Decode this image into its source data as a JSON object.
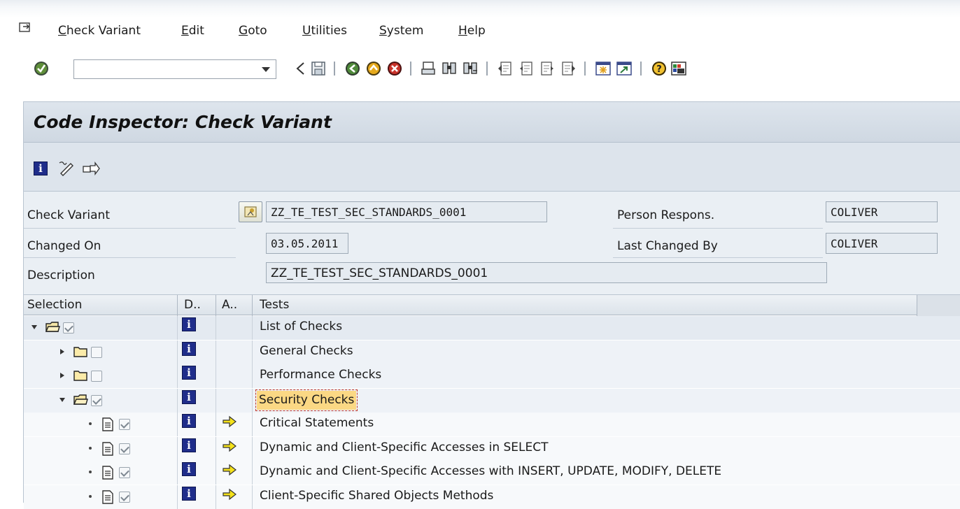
{
  "menubar": {
    "items": [
      "Check Variant",
      "Edit",
      "Goto",
      "Utilities",
      "System",
      "Help"
    ]
  },
  "toolbar": {
    "command_field_value": "",
    "icons": [
      "enter-icon",
      "back-icon",
      "save-icon",
      "back-green-icon",
      "exit-icon",
      "cancel-icon",
      "print-icon",
      "find-icon",
      "find-next-icon",
      "first-page-icon",
      "previous-page-icon",
      "next-page-icon",
      "last-page-icon",
      "create-session-icon",
      "shortcut-icon",
      "help-icon",
      "layout-icon"
    ]
  },
  "title": "Code Inspector: Check Variant",
  "app_toolbar": {
    "icons": [
      "info-icon",
      "edit-pencil-icon",
      "transport-icon"
    ]
  },
  "form": {
    "check_variant_label": "Check Variant",
    "check_variant_value": "ZZ_TE_TEST_SEC_STANDARDS_0001",
    "person_respons_label": "Person Respons.",
    "person_respons_value": "COLIVER",
    "changed_on_label": "Changed On",
    "changed_on_value": "03.05.2011",
    "last_changed_by_label": "Last Changed By",
    "last_changed_by_value": "COLIVER",
    "description_label": "Description",
    "description_value": "ZZ_TE_TEST_SEC_STANDARDS_0001"
  },
  "tree": {
    "headers": {
      "selection": "Selection",
      "d": "D..",
      "a": "A..",
      "tests": "Tests"
    },
    "rows": [
      {
        "label": "List of Checks",
        "level": 0,
        "kind": "folder-open",
        "checked": true,
        "arrow": false
      },
      {
        "label": "General Checks",
        "level": 1,
        "kind": "folder",
        "checked": false,
        "arrow": false
      },
      {
        "label": "Performance Checks",
        "level": 1,
        "kind": "folder",
        "checked": false,
        "arrow": false
      },
      {
        "label": "Security Checks",
        "level": 1,
        "kind": "folder-open",
        "checked": true,
        "arrow": false,
        "selected": true
      },
      {
        "label": "Critical Statements",
        "level": 2,
        "kind": "document",
        "checked": true,
        "arrow": true
      },
      {
        "label": "Dynamic and Client-Specific Accesses in SELECT",
        "level": 2,
        "kind": "document",
        "checked": true,
        "arrow": true
      },
      {
        "label": "Dynamic and Client-Specific Accesses with INSERT, UPDATE, MODIFY, DELETE",
        "level": 2,
        "kind": "document",
        "checked": true,
        "arrow": true
      },
      {
        "label": "Client-Specific Shared Objects Methods",
        "level": 2,
        "kind": "document",
        "checked": true,
        "arrow": true
      }
    ],
    "info_glyph": "i"
  }
}
